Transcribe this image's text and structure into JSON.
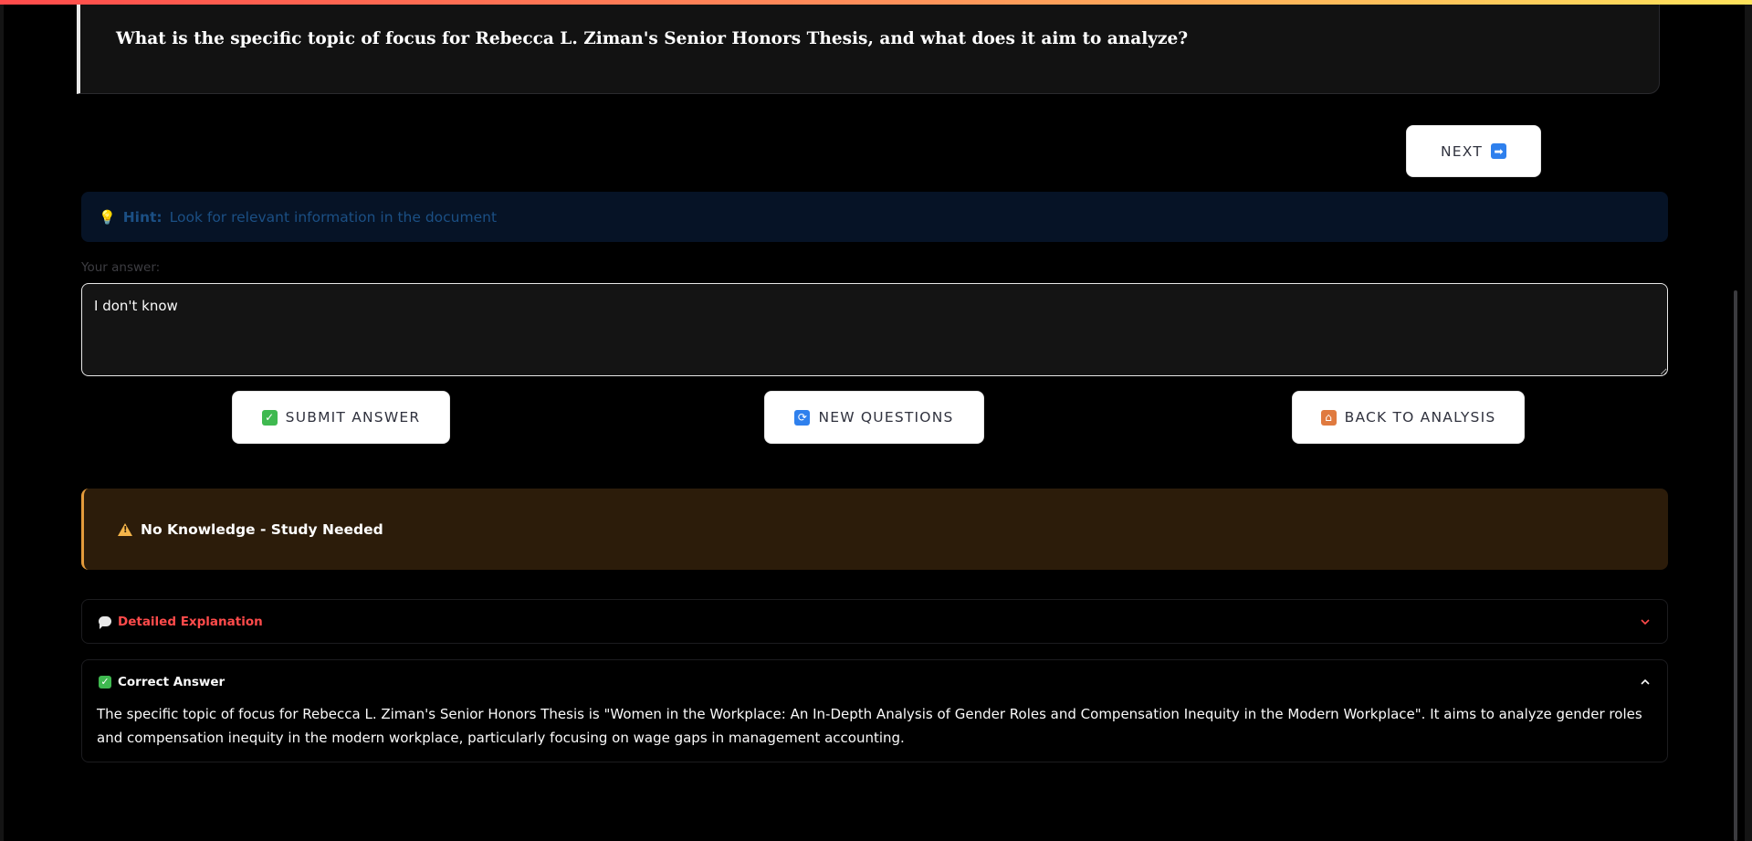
{
  "question": {
    "text": "What is the specific topic of focus for Rebecca L. Ziman's Senior Honors Thesis, and what does it aim to analyze?"
  },
  "buttons": {
    "next": {
      "label": "NEXT",
      "icon": "right-arrow-icon",
      "icon_glyph": "➡"
    },
    "submit": {
      "label": "SUBMIT ANSWER",
      "icon": "check-mark-icon",
      "icon_glyph": "✓"
    },
    "new_questions": {
      "label": "NEW QUESTIONS",
      "icon": "refresh-icon",
      "icon_glyph": "⟳"
    },
    "back": {
      "label": "BACK TO ANALYSIS",
      "icon": "house-icon",
      "icon_glyph": "⌂"
    }
  },
  "hint": {
    "label": "Hint:",
    "text": "Look for relevant information in the document"
  },
  "answer": {
    "label": "Your answer:",
    "value": "I don't know"
  },
  "status": {
    "text": "No Knowledge - Study Needed",
    "icon": "warning-icon"
  },
  "explanation": {
    "title": "Detailed Explanation",
    "icon": "speech-bubble-icon",
    "expanded": false
  },
  "correct_answer": {
    "title": "Correct Answer",
    "icon": "check-mark-icon",
    "expanded": true,
    "text": "The specific topic of focus for Rebecca L. Ziman's Senior Honors Thesis is \"Women in the Workplace: An In-Depth Analysis of Gender Roles and Compensation Inequity in the Modern Workplace\". It aims to analyze gender roles and compensation inequity in the modern workplace, particularly focusing on wage gaps in management accounting."
  },
  "colors": {
    "accent_red": "#ff4b4b",
    "hint_blue": "#1b4f84",
    "warning_orange": "#e39a3b",
    "status_bg": "#2c1c0a",
    "icon_blue": "#2f80ed",
    "icon_green": "#3fb950"
  }
}
